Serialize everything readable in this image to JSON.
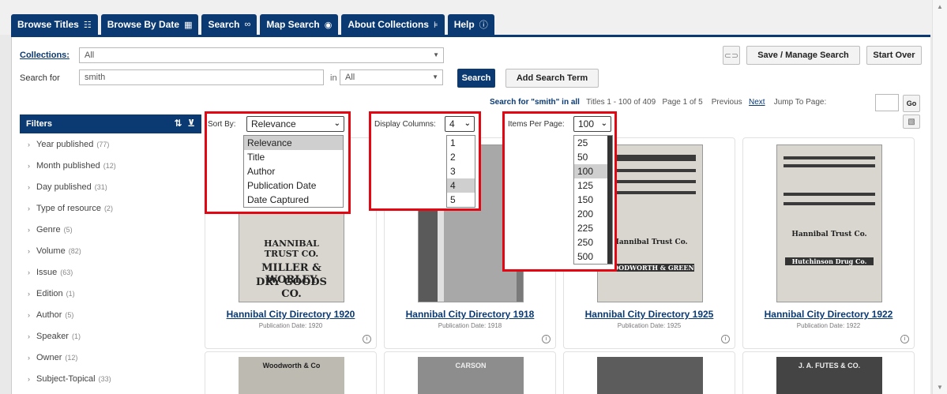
{
  "nav": {
    "tabs": [
      {
        "label": "Browse Titles",
        "icon": "list-filter-icon"
      },
      {
        "label": "Browse By Date",
        "icon": "calendar-icon"
      },
      {
        "label": "Search",
        "icon": "binoculars-icon"
      },
      {
        "label": "Map Search",
        "icon": "globe-icon"
      },
      {
        "label": "About Collections",
        "icon": "tree-icon"
      },
      {
        "label": "Help",
        "icon": "help-circle-icon"
      }
    ]
  },
  "search": {
    "collections_label": "Collections:",
    "collections_value": "All",
    "search_for_label": "Search for",
    "search_value": "smith",
    "in_label": "in",
    "in_value": "All",
    "search_button": "Search",
    "add_term_button": "Add Search Term",
    "save_button": "Save / Manage Search",
    "start_over_button": "Start Over",
    "link_icon": "link-icon"
  },
  "results": {
    "query_text": "Search for \"smith\" in all",
    "titles_range": "Titles 1 - 100 of 409",
    "page_info": "Page 1 of 5",
    "previous": "Previous",
    "next": "Next",
    "jump_label": "Jump To Page:",
    "go_button": "Go"
  },
  "filters": {
    "title": "Filters",
    "items": [
      {
        "label": "Year published",
        "count": "(77)"
      },
      {
        "label": "Month published",
        "count": "(12)"
      },
      {
        "label": "Day published",
        "count": "(31)"
      },
      {
        "label": "Type of resource",
        "count": "(2)"
      },
      {
        "label": "Genre",
        "count": "(5)"
      },
      {
        "label": "Volume",
        "count": "(82)"
      },
      {
        "label": "Issue",
        "count": "(63)"
      },
      {
        "label": "Edition",
        "count": "(1)"
      },
      {
        "label": "Author",
        "count": "(5)"
      },
      {
        "label": "Speaker",
        "count": "(1)"
      },
      {
        "label": "Owner",
        "count": "(12)"
      },
      {
        "label": "Subject-Topical",
        "count": "(33)"
      }
    ]
  },
  "controls": {
    "sort_label": "Sort By:",
    "sort_value": "Relevance",
    "sort_options": [
      "Relevance",
      "Title",
      "Author",
      "Publication Date",
      "Date Captured"
    ],
    "columns_label": "Display Columns:",
    "columns_value": "4",
    "columns_options": [
      "1",
      "2",
      "3",
      "4",
      "5"
    ],
    "items_label": "Items Per Page:",
    "items_value": "100",
    "items_options": [
      "25",
      "50",
      "100",
      "125",
      "150",
      "200",
      "225",
      "250",
      "500"
    ]
  },
  "cards": [
    {
      "title": "Hannibal City Directory 1920",
      "date": "Publication Date: 1920",
      "thumb_text": [
        "HANNIBAL TRUST CO.",
        "MILLER & WORLEY",
        "DRY GOODS CO."
      ]
    },
    {
      "title": "Hannibal City Directory 1918",
      "date": "Publication Date: 1918",
      "thumb_text": []
    },
    {
      "title": "Hannibal City Directory 1925",
      "date": "Publication Date: 1925",
      "thumb_text": [
        "Hannibal Trust Co.",
        "WOODWORTH & GREEN"
      ]
    },
    {
      "title": "Hannibal City Directory 1922",
      "date": "Publication Date: 1922",
      "thumb_text": [
        "Hannibal Trust Co.",
        "Hutchinson Drug Co."
      ]
    }
  ],
  "cards_row2": [
    {
      "thumb_text": "Woodworth & Co"
    },
    {
      "thumb_text": "CARSON"
    },
    {
      "thumb_text": ""
    },
    {
      "thumb_text": "J. A. FUTES & CO."
    }
  ]
}
